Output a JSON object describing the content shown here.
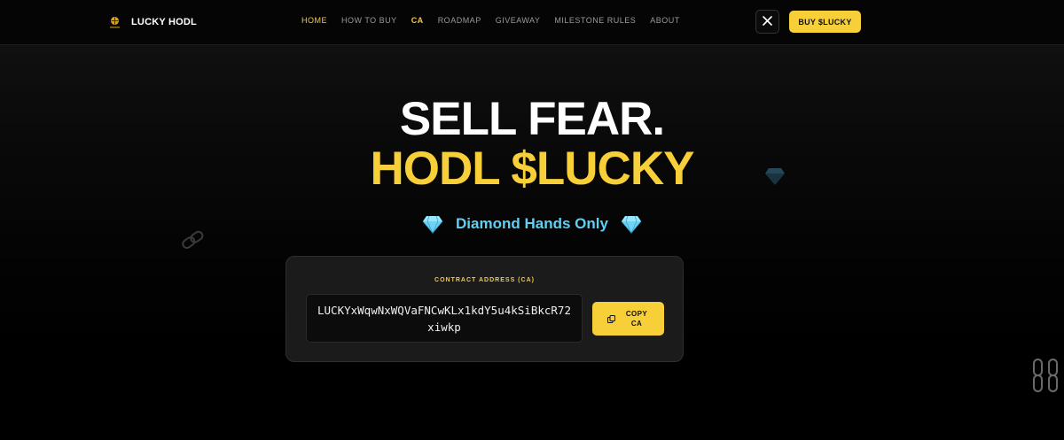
{
  "nav": {
    "brand": "LUCKY HODL",
    "links": [
      {
        "label": "HOME"
      },
      {
        "label": "HOW TO BUY"
      },
      {
        "label": "CA"
      },
      {
        "label": "ROADMAP"
      },
      {
        "label": "GIVEAWAY"
      },
      {
        "label": "MILESTONE RULES"
      },
      {
        "label": "ABOUT"
      }
    ],
    "buy_label": "BUY $LUCKY"
  },
  "hero": {
    "line1": "SELL FEAR.",
    "line2": "HODL $LUCKY",
    "tagline": "Diamond Hands Only"
  },
  "ca": {
    "label": "CONTRACT ADDRESS (CA)",
    "address": "LUCKYxWqwNxWQVaFNCwKLx1kdY5u4kSiBkcR72xiwkp",
    "copy_label": "COPY CA"
  },
  "colors": {
    "accent": "#f7cf38",
    "tagline": "#5fd0f2",
    "background": "#000000"
  },
  "icons": [
    "lucky-logo-icon",
    "x-icon",
    "diamond-icon",
    "chain-link-icon",
    "copy-icon"
  ]
}
